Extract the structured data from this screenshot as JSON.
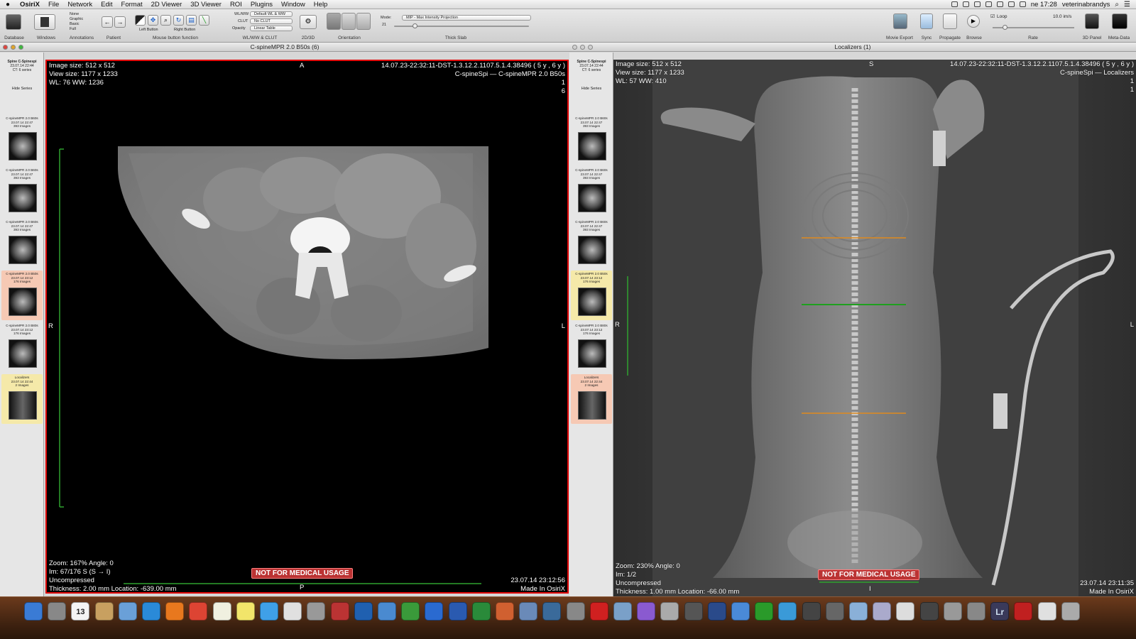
{
  "menubar": {
    "app": "OsiriX",
    "items": [
      "File",
      "Network",
      "Edit",
      "Format",
      "2D Viewer",
      "3D Viewer",
      "ROI",
      "Plugins",
      "Window",
      "Help"
    ],
    "clock": "ne 17:28",
    "user": "veterinabrandys"
  },
  "toolbar": {
    "labels": {
      "database": "Database",
      "windows": "Windows",
      "annotations": "Annotations",
      "patient": "Patient",
      "mouse": "Mouse button function",
      "wlclut": "WL/WW & CLUT",
      "d2d3": "2D/3D",
      "orientation": "Orientation",
      "thickslab": "Thick Slab",
      "movie_export": "Movie Export",
      "sync": "Sync",
      "propagate": "Propagate",
      "browse": "Browse",
      "rate": "Rate",
      "panel3d": "3D Panel",
      "metadata": "Meta-Data"
    },
    "annotation_options": [
      "None",
      "Graphic",
      "Basic",
      "Full"
    ],
    "mouse_options": [
      "Left Button",
      "Right Button"
    ],
    "wlww_label": "WL/WW",
    "wlww_value": "Default WL & WW",
    "clut_label": "CLUT",
    "clut_value": "No CLUT",
    "opacity_label": "Opacity",
    "opacity_value": "Linear Table",
    "mode_label": "Mode:",
    "mode_value": "MIP - Max Intensity Projection",
    "slab_value": "21",
    "loop_label": "Loop",
    "rate_value": "10.0 im/s"
  },
  "left_window": {
    "title": "C-spineMPR 2.0 B50s (6)",
    "header": {
      "name": "Spine C-Spinespi",
      "date": "23.07.14 22:44",
      "info": "CT: 6 series"
    },
    "hide_series": "Hide Series",
    "series": [
      {
        "name": "C-spineMPR 2.0 B60s",
        "date": "23.07.14 22:47",
        "count": "393 Images",
        "tint": "#e6e6e6"
      },
      {
        "name": "C-spineMPR 2.0 B60s",
        "date": "23.07.14 22:47",
        "count": "393 Images",
        "tint": "#e6e6e6"
      },
      {
        "name": "C-spineMPR 2.0 B60s",
        "date": "23.07.14 22:47",
        "count": "393 Images",
        "tint": "#e6e6e6"
      },
      {
        "name": "C-spineMPR 2.0 B50s",
        "date": "23.07.14 23:12",
        "count": "176 Images",
        "tint": "#f6c9b4"
      },
      {
        "name": "C-spineMPR 2.0 B80s",
        "date": "23.07.14 23:12",
        "count": "176 Images",
        "tint": "#e6e6e6"
      },
      {
        "name": "Localizers",
        "date": "23.07.14 22:44",
        "count": "2 Images",
        "tint": "#f5e9a9"
      }
    ],
    "overlay": {
      "image_size": "Image size: 512 x 512",
      "view_size": "View size: 1177 x 1233",
      "wl": "WL: 76 WW: 1236",
      "id": "14.07.23-22:32:11-DST-1.3.12.2.1107.5.1.4.38496 ( 5 y , 6 y )",
      "series": "C-spineSpi — C-spineMPR 2.0 B50s",
      "n1": "1",
      "n2": "6",
      "top": "A",
      "left": "R",
      "right": "L",
      "bottom": "P",
      "zoom": "Zoom: 167% Angle: 0",
      "im": "Im: 67/176  S (S → I)",
      "comp": "Uncompressed",
      "thickness": "Thickness: 2.00 mm Location: -639.00 mm",
      "date": "23.07.14 23:12:56",
      "made": "Made In OsiriX",
      "warning": "NOT FOR MEDICAL USAGE"
    }
  },
  "right_window": {
    "title": "Localizers (1)",
    "header": {
      "name": "Spine C-Spinespi",
      "date": "23.07.14 22:44",
      "info": "CT: 6 series"
    },
    "hide_series": "Hide Series",
    "series": [
      {
        "name": "C-spineMPR 2.0 B60s",
        "date": "23.07.14 22:47",
        "count": "393 Images",
        "tint": "#e6e6e6"
      },
      {
        "name": "C-spineMPR 2.0 B60s",
        "date": "23.07.14 22:47",
        "count": "393 Images",
        "tint": "#e6e6e6"
      },
      {
        "name": "C-spineMPR 2.0 B60s",
        "date": "23.07.14 22:47",
        "count": "393 Images",
        "tint": "#e6e6e6"
      },
      {
        "name": "C-spineMPR 2.0 B50s",
        "date": "23.07.14 23:12",
        "count": "176 Images",
        "tint": "#f5e9a9"
      },
      {
        "name": "C-spineMPR 2.0 B80s",
        "date": "23.07.14 23:12",
        "count": "176 Images",
        "tint": "#e6e6e6"
      },
      {
        "name": "Localizers",
        "date": "23.07.14 22:44",
        "count": "2 Images",
        "tint": "#f6c9b4"
      }
    ],
    "overlay": {
      "image_size": "Image size: 512 x 512",
      "view_size": "View size: 1177 x 1233",
      "wl": "WL: 57 WW: 410",
      "id": "14.07.23-22:32:11-DST-1.3.12.2.1107.5.1.4.38496 ( 5 y , 6 y )",
      "series": "C-spineSpi — Localizers",
      "n1": "1",
      "n2": "1",
      "top": "S",
      "left": "R",
      "right": "L",
      "bottom": "I",
      "zoom": "Zoom: 230% Angle: 0",
      "im": "Im: 1/2",
      "comp": "Uncompressed",
      "thickness": "Thickness: 1.00 mm Location: -66.00 mm",
      "date": "23.07.14 23:11:35",
      "made": "Made In OsiriX",
      "warning": "NOT FOR MEDICAL USAGE"
    }
  },
  "dock": {
    "calendar_day": "13",
    "lr_label": "Lr",
    "apps": [
      "finder",
      "launchpad",
      "calendar",
      "contacts",
      "preview",
      "safari",
      "firefox",
      "chrome",
      "textedit",
      "stickies",
      "messages",
      "pages",
      "calculator",
      "dictionary",
      "globe",
      "xcode",
      "numbers",
      "keynote",
      "word",
      "excel",
      "powerpoint",
      "photos",
      "iphoto",
      "camera",
      "acrobat",
      "vpn",
      "itunes",
      "imovie",
      "aperture",
      "quicktime",
      "screenflow",
      "facetime",
      "skype",
      "fcp",
      "osirix",
      "folder",
      "finder2",
      "home",
      "timemachine",
      "utility",
      "preferences",
      "lightroom",
      "acrobat2",
      "docs",
      "trash"
    ]
  },
  "colors": {
    "active_border": "#e00000",
    "localizer_orange": "#e08a1e",
    "localizer_green": "#1ea01e",
    "scale_green": "#2fa22f"
  }
}
